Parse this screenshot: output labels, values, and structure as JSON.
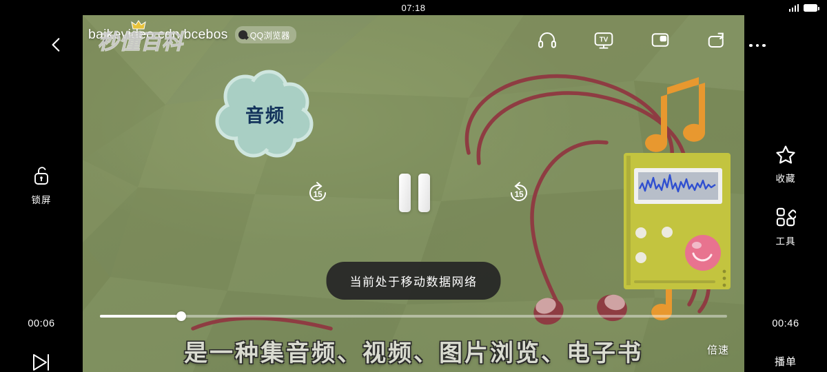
{
  "statusbar": {
    "time": "07:18",
    "signal_icon": "signal-bars-icon",
    "battery_icon": "battery-icon"
  },
  "player": {
    "title": "baikevideo.cdn.bcebos",
    "watermark": "秒懂百科",
    "source_badge": {
      "label": "QQ浏览器",
      "icon": "qq-browser-logo-icon"
    },
    "back_icon": "back-chevron-icon",
    "more_icon": "more-dots-icon",
    "top_icons": [
      {
        "name": "headphones-icon",
        "label": "音频模式"
      },
      {
        "name": "tv-cast-icon",
        "label": "投屏"
      },
      {
        "name": "picture-in-picture-icon",
        "label": "小窗"
      },
      {
        "name": "rotate-screen-icon",
        "label": "旋转"
      }
    ],
    "controls": {
      "rewind_seconds": "15",
      "forward_seconds": "15",
      "rewind_icon": "rewind-15-icon",
      "forward_icon": "forward-15-icon",
      "pause_icon": "pause-icon",
      "next_icon": "next-track-icon"
    },
    "progress": {
      "current_time": "00:06",
      "total_time": "00:46",
      "percent": 13
    },
    "toast": "当前处于移动数据网络",
    "subtitle": "是一种集音频、视频、图片浏览、电子书",
    "speed_label": "倍速",
    "playlist_label": "播单"
  },
  "rail_left": {
    "lock": {
      "label": "锁屏",
      "icon": "unlock-icon"
    }
  },
  "rail_right": {
    "items": [
      {
        "label": "收藏",
        "icon": "star-icon"
      },
      {
        "label": "工具",
        "icon": "tools-grid-icon"
      }
    ]
  },
  "scene": {
    "cloud_label": "音频",
    "colors": {
      "bg_green": "#7a8a5a",
      "cloud_fill": "#a9cfc4",
      "cloud_stroke": "#cfe6df",
      "cloud_text": "#13335b",
      "device_body": "#c3c43f",
      "device_screen": "#b7bec9",
      "waveform": "#2f4fd0",
      "note_orange": "#e8982f",
      "cable_red": "#8e3c42",
      "pink_button": "#e8738f"
    }
  }
}
